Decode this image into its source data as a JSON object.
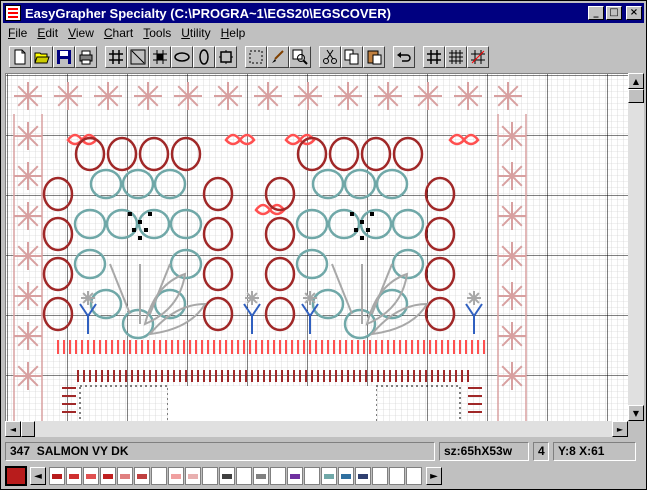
{
  "window": {
    "title": "EasyGrapher Specialty (C:\\PROGRA~1\\EGS20\\EGSCOVER)",
    "minimize_label": "_",
    "maximize_label": "□",
    "close_label": "×"
  },
  "menu": {
    "items": [
      {
        "hot": "F",
        "rest": "ile"
      },
      {
        "hot": "E",
        "rest": "dit"
      },
      {
        "hot": "V",
        "rest": "iew"
      },
      {
        "hot": "C",
        "rest": "hart"
      },
      {
        "hot": "T",
        "rest": "ools"
      },
      {
        "hot": "U",
        "rest": "tility"
      },
      {
        "hot": "H",
        "rest": "elp"
      }
    ]
  },
  "toolbar": {
    "icons": [
      "new-icon",
      "open-icon",
      "save-icon",
      "print-icon",
      "grid-icon",
      "line-icon",
      "grid-fill-icon",
      "ellipse-icon",
      "circle-icon",
      "box-icon",
      "select-icon",
      "brush-icon",
      "zoom-icon",
      "cut-icon",
      "copy-icon",
      "paste-icon",
      "undo-icon",
      "grid-a-icon",
      "grid-b-icon",
      "grid-c-icon"
    ]
  },
  "colors": {
    "pink_border": "#d8a0a0",
    "salmon": "#ff5050",
    "dark_red": "#a02828",
    "teal": "#70a8a8",
    "gray": "#a8a8a8",
    "blue": "#3060c0",
    "grid_minor": "#c8c8c8",
    "grid_major": "#000000",
    "current_color": "#b81c1c"
  },
  "status": {
    "color_code": "347",
    "color_name": "SALMON VY DK",
    "size": "sz:65hX53w",
    "field_num": "4",
    "position": "Y:8 X:61"
  },
  "palette": {
    "prev_label": "◄",
    "next_label": "►",
    "swatches": [
      "#b81c1c",
      "#d03030",
      "#e05050",
      "#c02020",
      "#e08080",
      "#c04040",
      "#ffffff",
      "#f0a0a0",
      "#e8b0b0",
      "#ffffff",
      "#404040",
      "#ffffff",
      "#808080",
      "#ffffff",
      "#7030a0",
      "#ffffff",
      "#70a8a8",
      "#3070a0",
      "#304070",
      "#ffffff",
      "#ffffff",
      "#ffffff"
    ]
  }
}
